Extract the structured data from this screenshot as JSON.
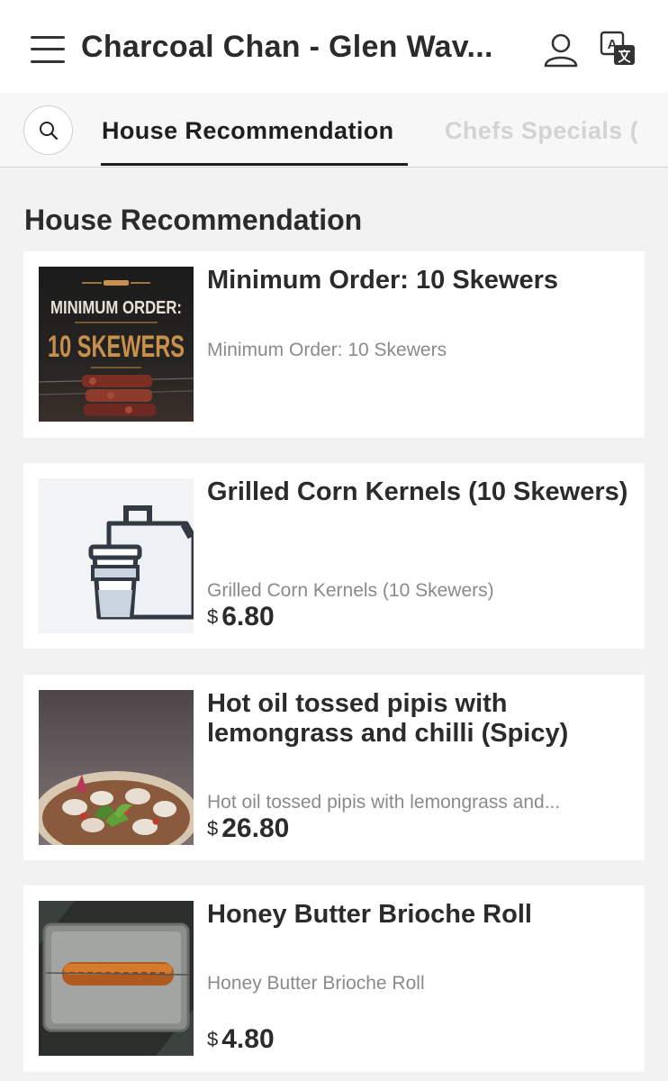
{
  "header": {
    "title": "Charcoal Chan - Glen Wav...",
    "icons": {
      "menu": "hamburger-menu-icon",
      "account": "user-icon",
      "language": "translate-icon"
    }
  },
  "tabs": {
    "search_icon": "search-icon",
    "items": [
      {
        "label": "House Recommendation",
        "active": true
      },
      {
        "label": "Chefs Specials (",
        "active": false
      }
    ]
  },
  "section": {
    "title": "House Recommendation"
  },
  "items": [
    {
      "name": "Minimum Order: 10 Skewers",
      "description": "Minimum Order: 10 Skewers",
      "image": {
        "line1": "MINIMUM ORDER:",
        "line2": "10 SKEWERS"
      }
    },
    {
      "name": "Grilled Corn Kernels (10 Skewers)",
      "description": "Grilled Corn Kernels (10 Skewers)",
      "currency": "$",
      "price": "6.80",
      "image": {
        "icon": "takeaway-bag-cup-icon"
      }
    },
    {
      "name": "Hot oil tossed pipis with lemongrass and chilli (Spicy)",
      "description": "Hot oil tossed pipis with lemongrass and...",
      "currency": "$",
      "price": "26.80"
    },
    {
      "name": "Honey Butter Brioche Roll",
      "description": "Honey Butter Brioche Roll",
      "currency": "$",
      "price": "4.80"
    }
  ],
  "colors": {
    "background": "#f2f2f2",
    "card": "#ffffff",
    "text": "#2b2b2b",
    "muted": "#8a8a8a",
    "inactive_tab": "#d3d3d3",
    "skewer_gold": "#c8904a"
  }
}
